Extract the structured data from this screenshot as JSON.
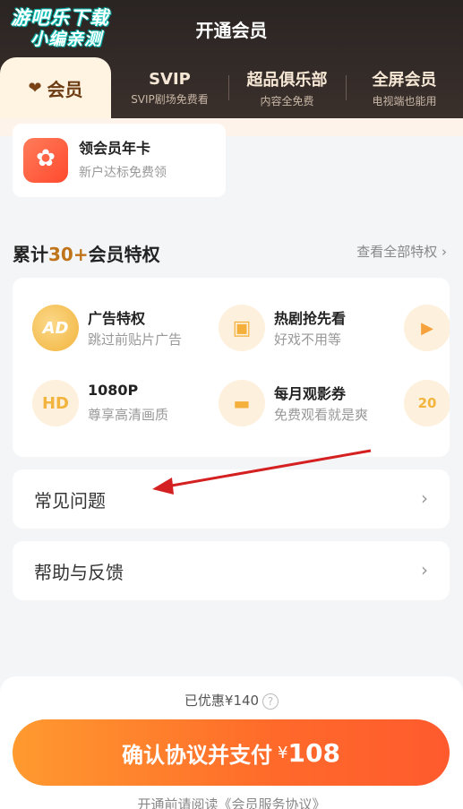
{
  "watermark": {
    "line1": "游吧乐下载",
    "line2": "小编亲测"
  },
  "header": {
    "title": "开通会员"
  },
  "tabs": {
    "active": {
      "label": "会员"
    },
    "items": [
      {
        "title": "SVIP",
        "subtitle": "SVIP剧场免费看"
      },
      {
        "title": "超品俱乐部",
        "subtitle": "内容全免费"
      },
      {
        "title": "全屏会员",
        "subtitle": "电视端也能用"
      }
    ]
  },
  "gift": {
    "title": "领会员年卡",
    "subtitle": "新户达标免费领"
  },
  "privileges": {
    "title_prefix": "累计",
    "title_count": "30+",
    "title_suffix": "会员特权",
    "see_all": "查看全部特权",
    "items": [
      {
        "icon": "AD",
        "name": "广告特权",
        "desc": "跳过前贴片广告"
      },
      {
        "icon": "sofa-icon",
        "name": "热剧抢先看",
        "desc": "好戏不用等"
      },
      {
        "icon": "HD",
        "name": "1080P",
        "desc": "尊享高清画质"
      },
      {
        "icon": "ticket-icon",
        "name": "每月观影券",
        "desc": "免费观看就是爽"
      },
      {
        "icon": "flame-play-icon"
      },
      {
        "icon": "20"
      }
    ]
  },
  "rows": [
    {
      "label": "常见问题"
    },
    {
      "label": "帮助与反馈"
    }
  ],
  "payment": {
    "discount": "已优惠¥140",
    "button_label": "确认协议并支付",
    "currency": "¥",
    "price": "108",
    "agreement": "开通前请阅读《会员服务协议》"
  },
  "colors": {
    "accent_orange": "#ff6a2a",
    "gold": "#c0741a",
    "annotation_arrow": "#d42020"
  }
}
